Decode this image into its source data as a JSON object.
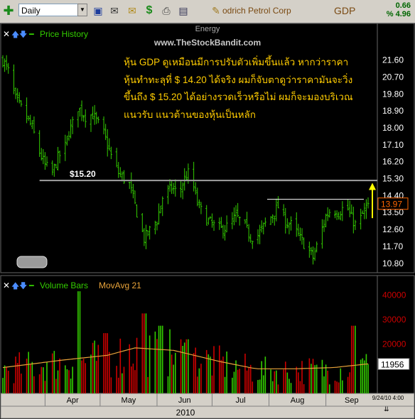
{
  "toolbar": {
    "interval_label": "Daily",
    "symbol_name": "odrich Petrol Corp",
    "ticker": "GDP",
    "change_value": "0.66",
    "change_percent": "% 4.96",
    "icons": [
      "add-icon",
      "save-icon",
      "mail-icon",
      "open-mail-icon",
      "dollar-icon",
      "print-icon",
      "card-icon",
      "pencil-icon"
    ]
  },
  "price_panel": {
    "legend_label": "Price History",
    "sector_label": "Energy",
    "watermark": "www.TheStockBandit.com",
    "level_label": "$15.20",
    "current_price": "13.97",
    "note_lines": [
      "หุ้น   GDP ดูเหมือนมีการปรับตัวเพิ่มขึ้นแล้ว   หากว่าราคา",
      "หุ้นทำทะลุที่   $ 14.20 ได้จริง   ผมก็จับตาดูว่าราคามันจะวิ่ง",
      "ขึ้นถึง   $ 15.20 ได้อย่างรวดเร็วหรือไม่   ผมก็จะมองบริเวณ",
      "แนวรับ   แนวต้านของหุ้นเป็นหลัก"
    ]
  },
  "volume_panel": {
    "legend_label": "Volume Bars",
    "ma_label": "MovAvg 21",
    "current_volume": "11956"
  },
  "footer": {
    "months": [
      "Apr",
      "May",
      "Jun",
      "Jul",
      "Aug",
      "Sep"
    ],
    "year": "2010",
    "date_stamp": "9/24/10 4:00"
  },
  "colors": {
    "up_bar": "#33cc00",
    "down_bar": "#cc0000",
    "moving_average": "#e8a33a",
    "support_line": "#a0a0a0",
    "resistance_line": "#ffffff",
    "axis_label_price": "#ffffff",
    "axis_label_volume": "#cc0000",
    "note_text": "#ffcc00",
    "arrow": "#ffff00"
  },
  "chart_data": [
    {
      "type": "ohlc",
      "title": "Price History",
      "x_range": [
        "2010-03-09",
        "2010-09-24"
      ],
      "y_ticks": [
        10.8,
        11.7,
        12.6,
        13.5,
        14.4,
        15.3,
        16.2,
        17.1,
        18.0,
        18.9,
        19.8,
        20.7,
        21.6
      ],
      "ylim": [
        10.3,
        22.3
      ],
      "horizontal_levels": [
        {
          "label": "$15.20",
          "value": 15.2,
          "role": "support-resistance"
        },
        {
          "value": 14.2,
          "role": "breakout-level"
        }
      ],
      "last_value": 13.97,
      "keypoints": [
        [
          "2010-03-09",
          21.6
        ],
        [
          "2010-03-12",
          21.0
        ],
        [
          "2010-03-16",
          19.5
        ],
        [
          "2010-03-20",
          18.9
        ],
        [
          "2010-03-25",
          18.0
        ],
        [
          "2010-03-29",
          16.7
        ],
        [
          "2010-04-01",
          16.0
        ],
        [
          "2010-04-05",
          15.6
        ],
        [
          "2010-04-08",
          16.4
        ],
        [
          "2010-04-12",
          17.0
        ],
        [
          "2010-04-14",
          17.8
        ],
        [
          "2010-04-16",
          18.2
        ],
        [
          "2010-04-19",
          19.1
        ],
        [
          "2010-04-23",
          18.6
        ],
        [
          "2010-04-27",
          18.7
        ],
        [
          "2010-05-03",
          17.7
        ],
        [
          "2010-05-07",
          16.5
        ],
        [
          "2010-05-11",
          15.6
        ],
        [
          "2010-05-17",
          15.0
        ],
        [
          "2010-05-21",
          13.5
        ],
        [
          "2010-05-25",
          12.1
        ],
        [
          "2010-05-27",
          12.4
        ],
        [
          "2010-06-01",
          13.1
        ],
        [
          "2010-06-04",
          14.3
        ],
        [
          "2010-06-09",
          14.8
        ],
        [
          "2010-06-13",
          14.5
        ],
        [
          "2010-06-16",
          15.3
        ],
        [
          "2010-06-19",
          15.7
        ],
        [
          "2010-06-23",
          14.0
        ],
        [
          "2010-06-27",
          13.2
        ],
        [
          "2010-07-02",
          12.8
        ],
        [
          "2010-07-06",
          12.6
        ],
        [
          "2010-07-10",
          12.8
        ],
        [
          "2010-07-14",
          13.3
        ],
        [
          "2010-07-18",
          12.9
        ],
        [
          "2010-07-22",
          12.2
        ],
        [
          "2010-07-26",
          12.3
        ],
        [
          "2010-07-30",
          12.9
        ],
        [
          "2010-08-03",
          13.4
        ],
        [
          "2010-08-06",
          13.8
        ],
        [
          "2010-08-10",
          13.0
        ],
        [
          "2010-08-14",
          12.8
        ],
        [
          "2010-08-18",
          12.1
        ],
        [
          "2010-08-22",
          11.6
        ],
        [
          "2010-08-25",
          11.1
        ],
        [
          "2010-08-28",
          12.0
        ],
        [
          "2010-09-01",
          13.3
        ],
        [
          "2010-09-04",
          13.7
        ],
        [
          "2010-09-08",
          13.5
        ],
        [
          "2010-09-12",
          13.9
        ],
        [
          "2010-09-15",
          13.2
        ],
        [
          "2010-09-18",
          12.7
        ],
        [
          "2010-09-21",
          13.4
        ],
        [
          "2010-09-24",
          13.97
        ]
      ]
    },
    {
      "type": "bar",
      "title": "Volume Bars",
      "y_ticks": [
        20000,
        30000,
        40000
      ],
      "ylim": [
        0,
        45000
      ],
      "last_value": 11956,
      "moving_average_period": 21,
      "moving_average_keypoints": [
        [
          "2010-03-09",
          10500
        ],
        [
          "2010-04-10",
          13500
        ],
        [
          "2010-05-05",
          15500
        ],
        [
          "2010-05-20",
          18500
        ],
        [
          "2010-06-10",
          17500
        ],
        [
          "2010-07-05",
          13000
        ],
        [
          "2010-07-25",
          10000
        ],
        [
          "2010-08-15",
          10000
        ],
        [
          "2010-09-05",
          10500
        ],
        [
          "2010-09-24",
          12000
        ]
      ],
      "notable_spikes": [
        [
          "2010-04-19",
          41500
        ],
        [
          "2010-05-04",
          24500
        ],
        [
          "2010-05-25",
          32500
        ],
        [
          "2010-06-03",
          27500
        ],
        [
          "2010-06-18",
          22000
        ],
        [
          "2010-09-16",
          27500
        ]
      ]
    }
  ]
}
